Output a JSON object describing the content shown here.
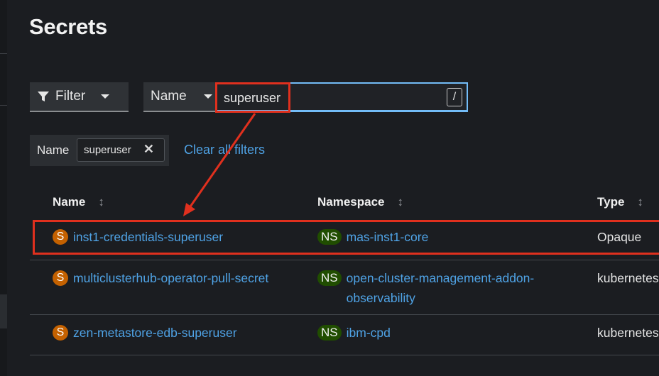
{
  "page": {
    "title": "Secrets"
  },
  "toolbar": {
    "filter_label": "Filter",
    "attribute_label": "Name",
    "search_value": "superuser",
    "shortcut_key": "/"
  },
  "active_filters": {
    "category": "Name",
    "chip_value": "superuser",
    "clear_label": "Clear all filters"
  },
  "table": {
    "columns": [
      "Name",
      "Namespace",
      "Type"
    ],
    "rows": [
      {
        "badge": "S",
        "name": "inst1-credentials-superuser",
        "ns_badge": "NS",
        "namespace": [
          "mas-inst1-core"
        ],
        "type": "Opaque"
      },
      {
        "badge": "S",
        "name": "multiclusterhub-operator-pull-secret",
        "ns_badge": "NS",
        "namespace": [
          "open-cluster-management-addon-",
          "observability"
        ],
        "type": "kubernetes"
      },
      {
        "badge": "S",
        "name": "zen-metastore-edb-superuser",
        "ns_badge": "NS",
        "namespace": [
          "ibm-cpd"
        ],
        "type": "kubernetes"
      }
    ]
  },
  "colors": {
    "background": "#1b1d21",
    "link": "#4fa3e6",
    "secret_badge": "#c46100",
    "namespace_badge": "#204d00",
    "annotation_red": "#e0301e",
    "focus_blue": "#73bcf7"
  },
  "icons": {
    "filter": "funnel-icon",
    "clear_chip": "close-icon",
    "sort": "sort-icon"
  }
}
